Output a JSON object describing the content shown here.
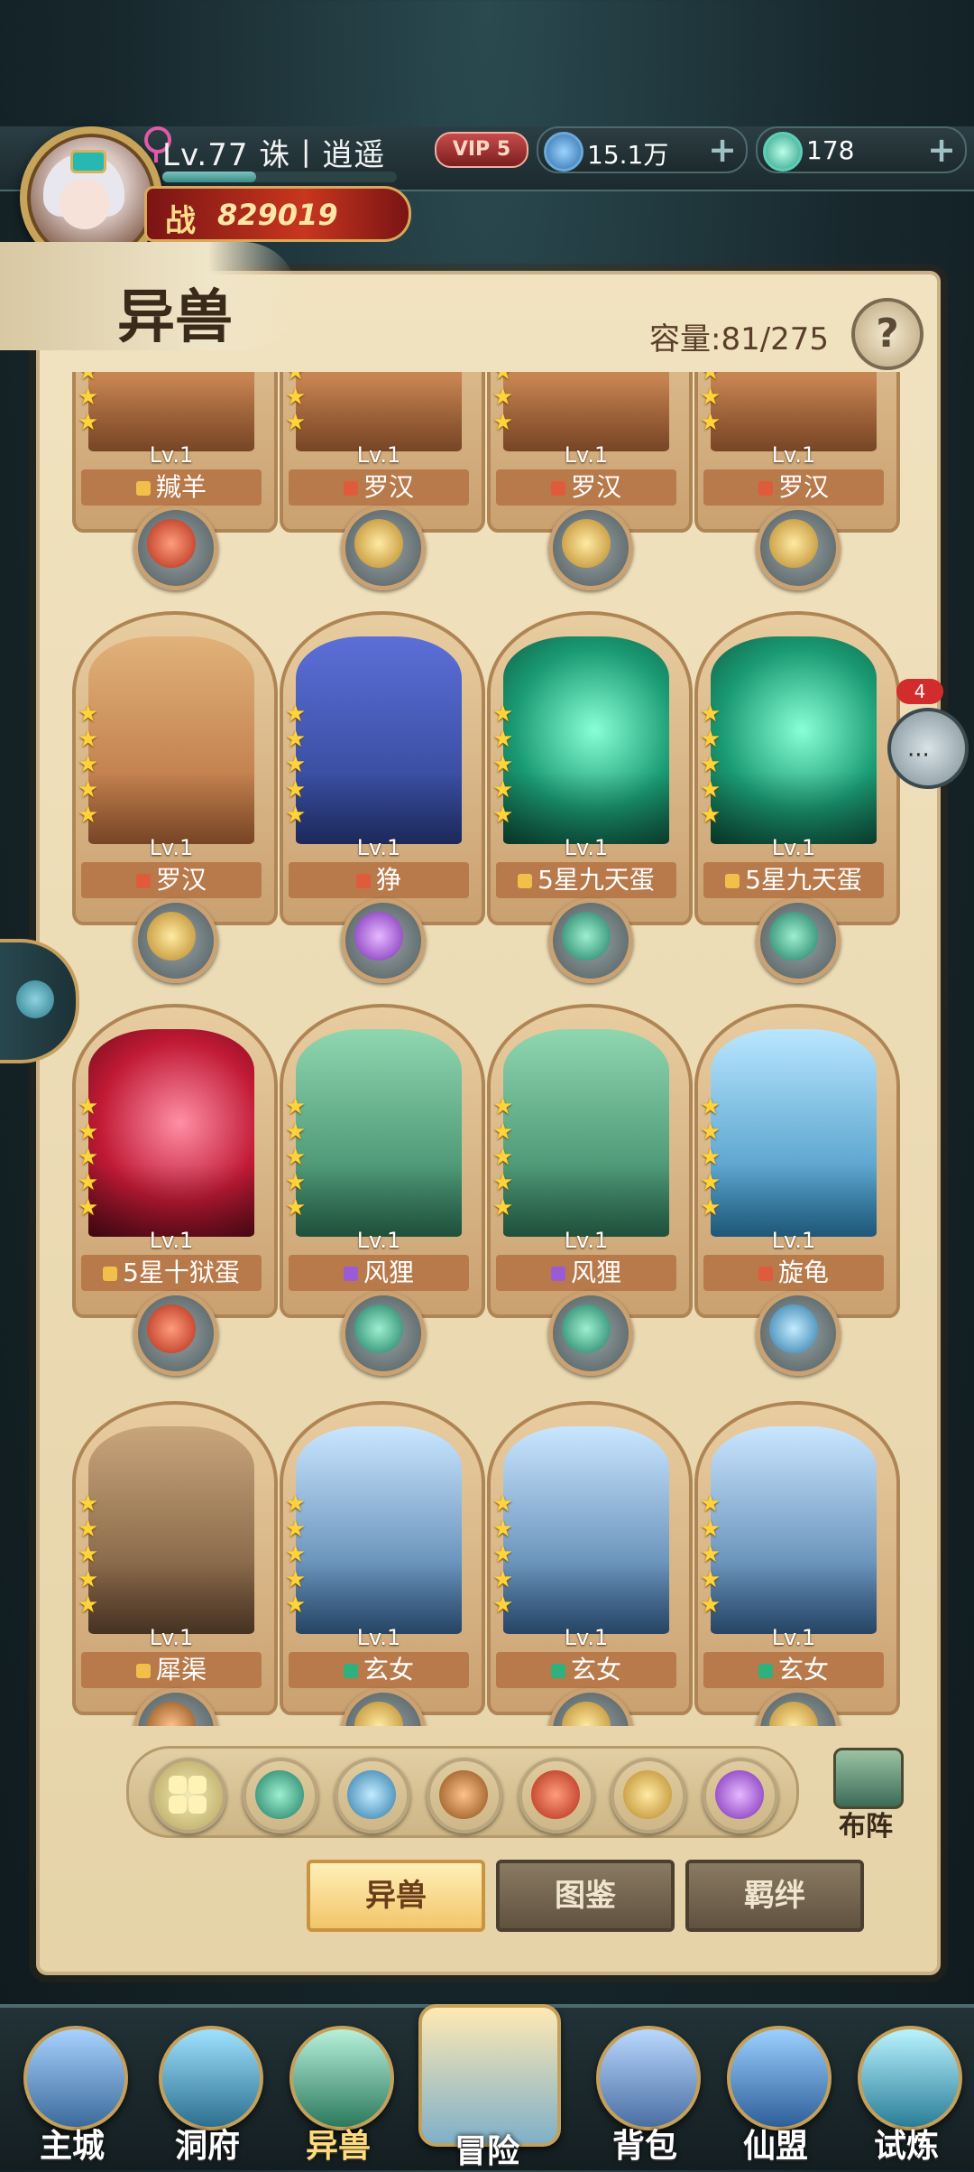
{
  "header": {
    "player": {
      "name": "Lv.77 诛丨逍遥",
      "power_label": "战",
      "power": "829019",
      "vip": "VIP 5"
    },
    "currencies": [
      {
        "icon": "spirit-coin-icon",
        "amount": "15.1万",
        "plus": "+"
      },
      {
        "icon": "jade-icon",
        "amount": "178",
        "plus": "+"
      }
    ]
  },
  "page": {
    "title": "异兽",
    "capacity": "容量:81/275",
    "help_label": "?"
  },
  "grid": {
    "cards": [
      {
        "level": "Lv.1",
        "name": "羬羊",
        "quality": "gold",
        "element": "fire",
        "portrait": "monk",
        "stars": 5
      },
      {
        "level": "Lv.1",
        "name": "罗汉",
        "quality": "red",
        "element": "sun",
        "portrait": "monk",
        "stars": 5
      },
      {
        "level": "Lv.1",
        "name": "罗汉",
        "quality": "red",
        "element": "sun",
        "portrait": "monk",
        "stars": 5
      },
      {
        "level": "Lv.1",
        "name": "罗汉",
        "quality": "red",
        "element": "sun",
        "portrait": "monk",
        "stars": 5
      },
      {
        "level": "Lv.1",
        "name": "罗汉",
        "quality": "red",
        "element": "sun",
        "portrait": "monk",
        "stars": 5
      },
      {
        "level": "Lv.1",
        "name": "狰",
        "quality": "red",
        "element": "purple",
        "portrait": "wolf",
        "stars": 5
      },
      {
        "level": "Lv.1",
        "name": "5星九天蛋",
        "quality": "gold",
        "element": "wind",
        "portrait": "egg-green",
        "stars": 5
      },
      {
        "level": "Lv.1",
        "name": "5星九天蛋",
        "quality": "gold",
        "element": "wind",
        "portrait": "egg-green",
        "stars": 5
      },
      {
        "level": "Lv.1",
        "name": "5星十狱蛋",
        "quality": "gold",
        "element": "fire",
        "portrait": "egg-red",
        "stars": 5
      },
      {
        "level": "Lv.1",
        "name": "风狸",
        "quality": "purple",
        "element": "wind",
        "portrait": "dragon",
        "stars": 5
      },
      {
        "level": "Lv.1",
        "name": "风狸",
        "quality": "purple",
        "element": "wind",
        "portrait": "dragon",
        "stars": 5
      },
      {
        "level": "Lv.1",
        "name": "旋龟",
        "quality": "red",
        "element": "water",
        "portrait": "bird",
        "stars": 5
      },
      {
        "level": "Lv.1",
        "name": "犀渠",
        "quality": "gold",
        "element": "earth",
        "portrait": "beast",
        "stars": 5
      },
      {
        "level": "Lv.1",
        "name": "玄女",
        "quality": "green",
        "element": "sun",
        "portrait": "maiden",
        "stars": 5
      },
      {
        "level": "Lv.1",
        "name": "玄女",
        "quality": "green",
        "element": "sun",
        "portrait": "maiden",
        "stars": 5
      },
      {
        "level": "Lv.1",
        "name": "玄女",
        "quality": "green",
        "element": "sun",
        "portrait": "maiden",
        "stars": 5
      }
    ]
  },
  "filters": {
    "items": [
      {
        "name": "filter-all",
        "icon": "grid-icon"
      },
      {
        "name": "filter-wind",
        "icon": "wind-element-icon"
      },
      {
        "name": "filter-water",
        "icon": "water-element-icon"
      },
      {
        "name": "filter-earth",
        "icon": "earth-element-icon"
      },
      {
        "name": "filter-fire",
        "icon": "fire-element-icon"
      },
      {
        "name": "filter-sun",
        "icon": "sun-element-icon"
      },
      {
        "name": "filter-purple",
        "icon": "void-element-icon"
      }
    ],
    "formation_label": "布阵"
  },
  "tabs": [
    {
      "label": "异兽",
      "active": true
    },
    {
      "label": "图鉴",
      "active": false
    },
    {
      "label": "羁绊",
      "active": false
    }
  ],
  "chat": {
    "badge": "4",
    "dots": "···"
  },
  "bottom_nav": [
    {
      "label": "主城",
      "icon": "city-icon"
    },
    {
      "label": "洞府",
      "icon": "cave-icon"
    },
    {
      "label": "异兽",
      "icon": "beast-icon",
      "active": true
    },
    {
      "label": "冒险",
      "icon": "adventure-map-icon",
      "featured": true
    },
    {
      "label": "背包",
      "icon": "bag-icon"
    },
    {
      "label": "仙盟",
      "icon": "guild-icon"
    },
    {
      "label": "试炼",
      "icon": "trial-icon"
    }
  ],
  "colors": {
    "panel": "#f1e3c0",
    "frame": "#caa171",
    "accent": "#c8a45a"
  }
}
